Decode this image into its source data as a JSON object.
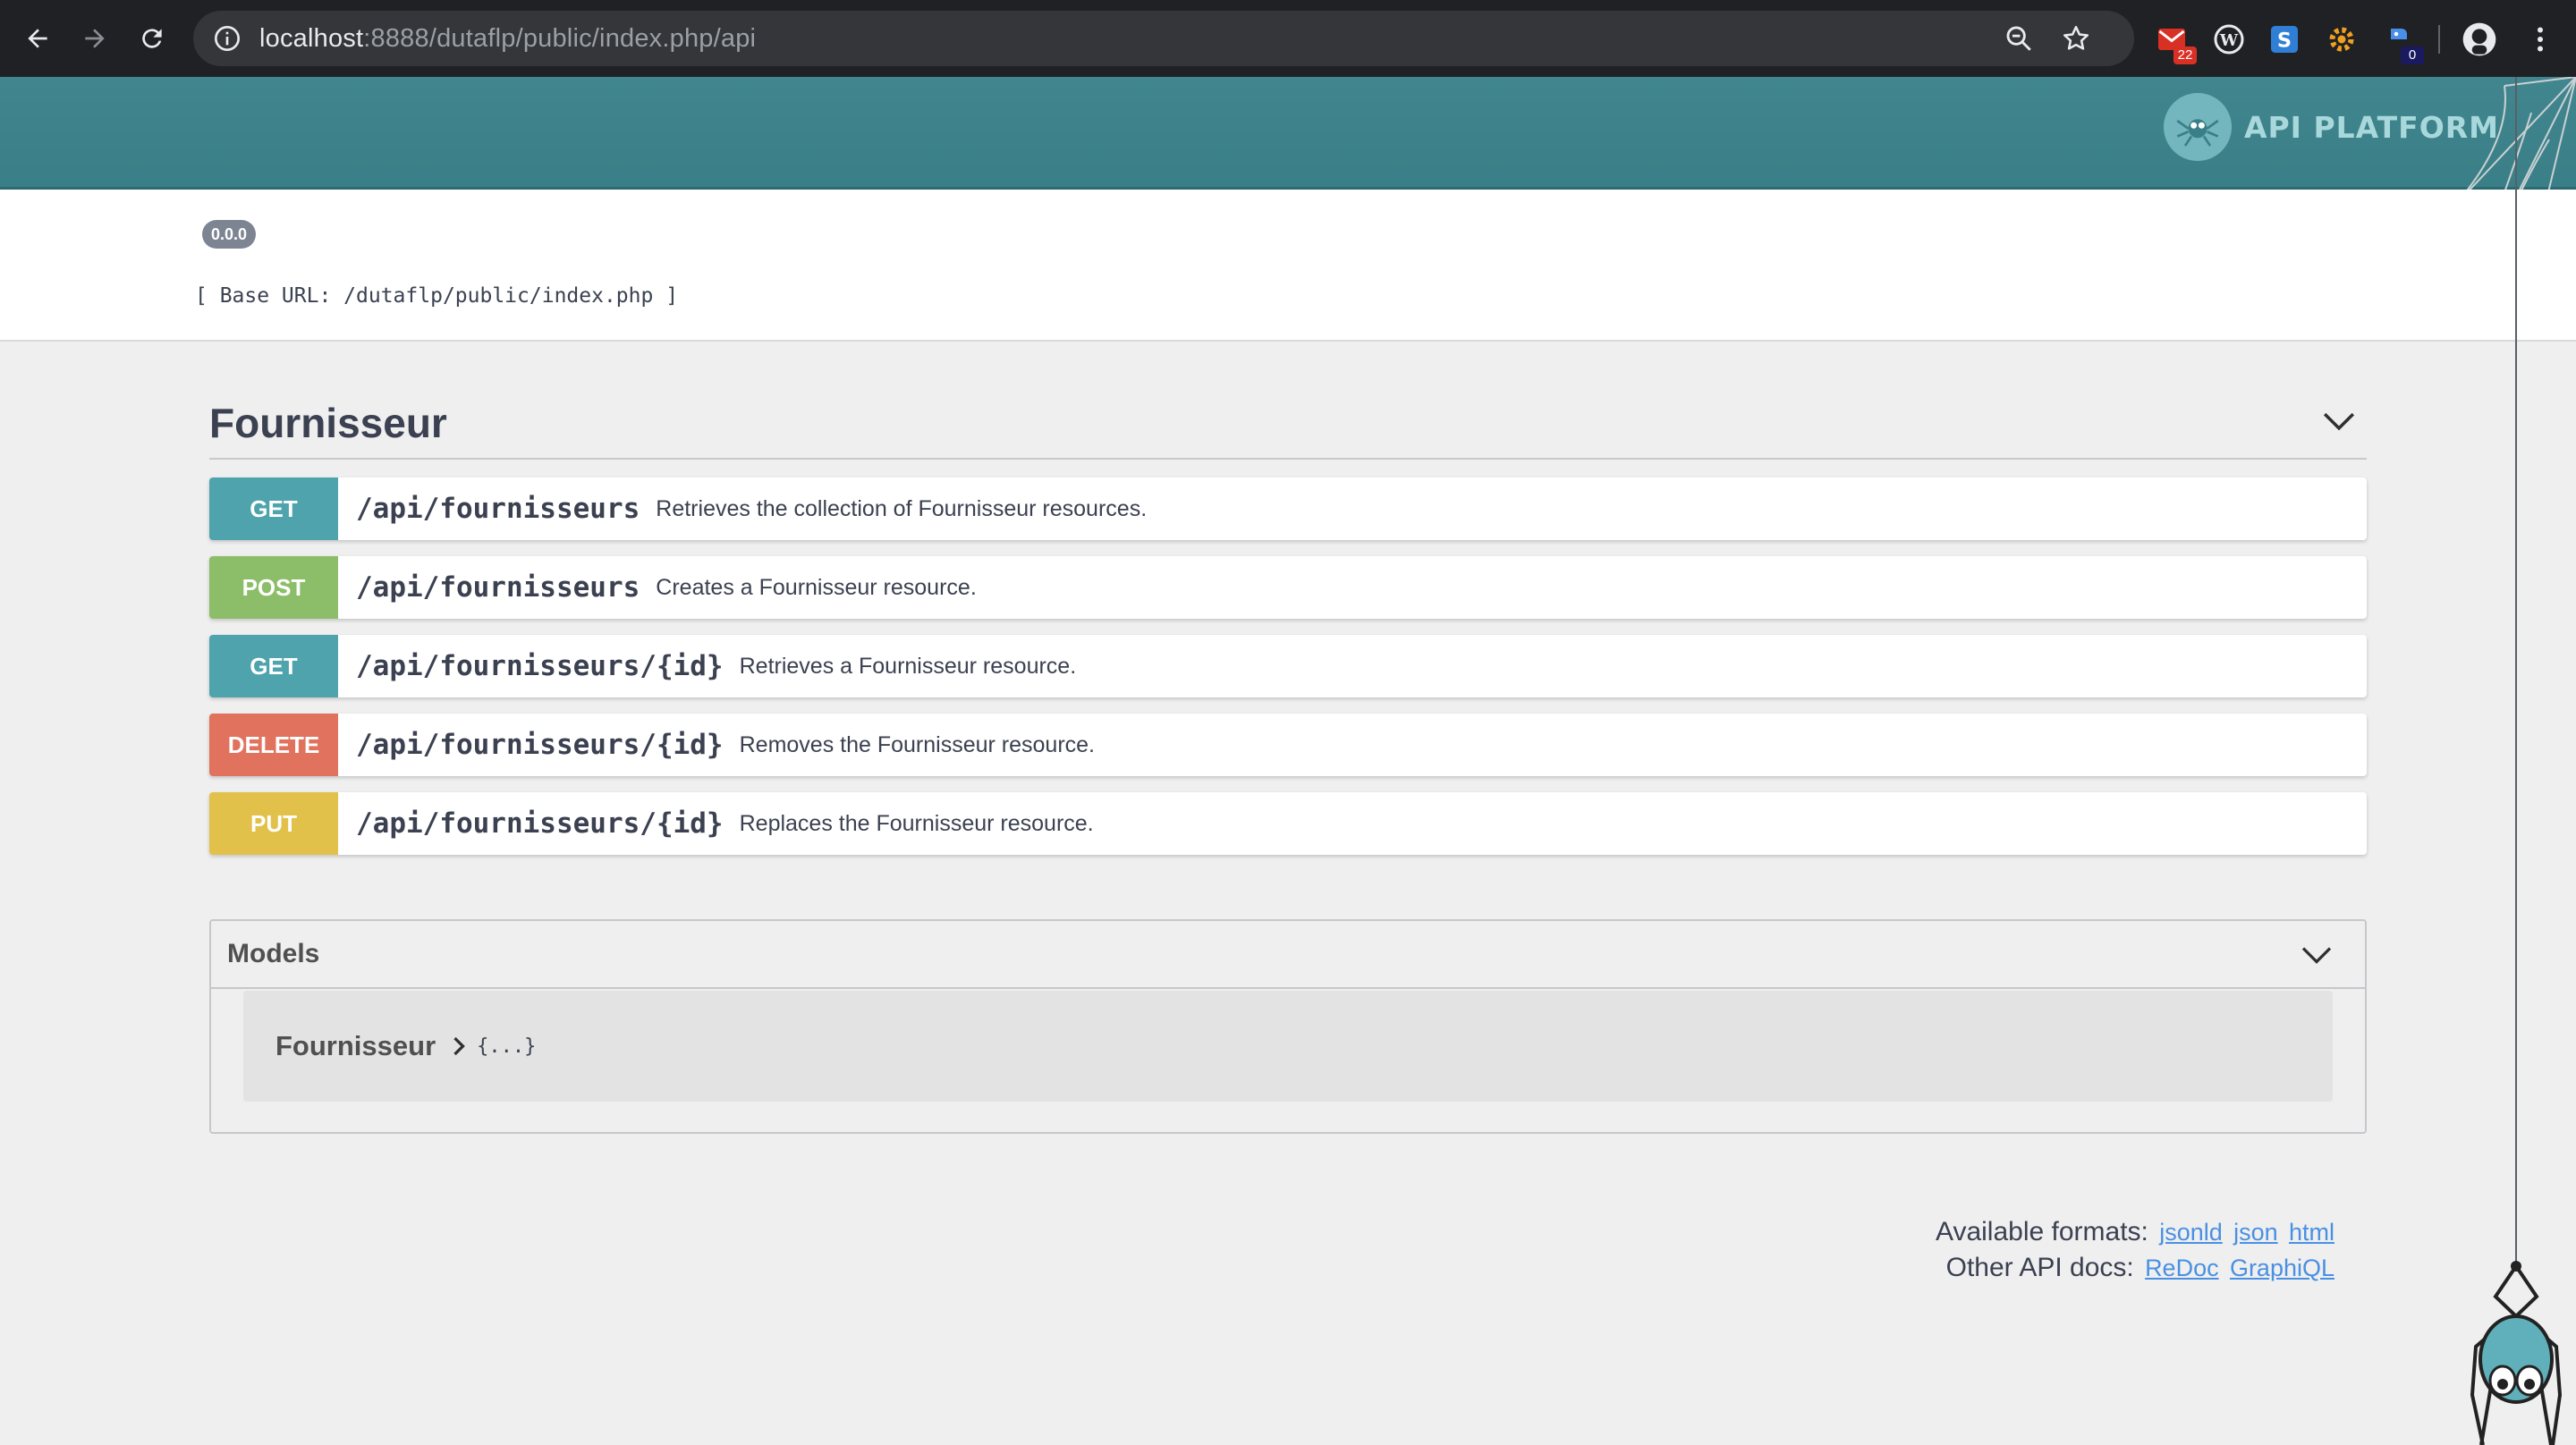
{
  "browser": {
    "url_host": "localhost",
    "url_rest": ":8888/dutaflp/public/index.php/api",
    "extensions": [
      {
        "name": "gmail-extension",
        "badge": "22",
        "badge_color": "#d93025"
      },
      {
        "name": "wordpress-extension"
      },
      {
        "name": "s-extension"
      },
      {
        "name": "gear-extension"
      },
      {
        "name": "puzzle-extension",
        "badge": "0",
        "badge_color": "#1a1a60"
      }
    ]
  },
  "header": {
    "logo_text": "API PLATFORM"
  },
  "info": {
    "version": "0.0.0",
    "base_url": "[ Base URL: /dutaflp/public/index.php ]"
  },
  "section": {
    "title": "Fournisseur"
  },
  "operations": [
    {
      "method": "GET",
      "color": "#61affe",
      "path": "/api/fournisseurs",
      "summary": "Retrieves the collection of Fournisseur resources."
    },
    {
      "method": "POST",
      "color": "#49cc90",
      "path": "/api/fournisseurs",
      "summary": "Creates a Fournisseur resource."
    },
    {
      "method": "GET",
      "color": "#61affe",
      "path": "/api/fournisseurs/{id}",
      "summary": "Retrieves a Fournisseur resource."
    },
    {
      "method": "DELETE",
      "color": "#f93e3e",
      "path": "/api/fournisseurs/{id}",
      "summary": "Removes the Fournisseur resource."
    },
    {
      "method": "PUT",
      "color": "#fca130",
      "path": "/api/fournisseurs/{id}",
      "summary": "Replaces the Fournisseur resource."
    }
  ],
  "method_colors": {
    "GET": "#4fa3ad",
    "POST": "#8cbe69",
    "DELETE": "#e0725e",
    "PUT": "#e2c14a"
  },
  "models": {
    "title": "Models",
    "items": [
      {
        "name": "Fournisseur",
        "preview": "{...}"
      }
    ]
  },
  "footer": {
    "formats_label": "Available formats:",
    "formats": [
      "jsonld",
      "json",
      "html"
    ],
    "docs_label": "Other API docs:",
    "docs": [
      "ReDoc",
      "GraphiQL"
    ]
  }
}
